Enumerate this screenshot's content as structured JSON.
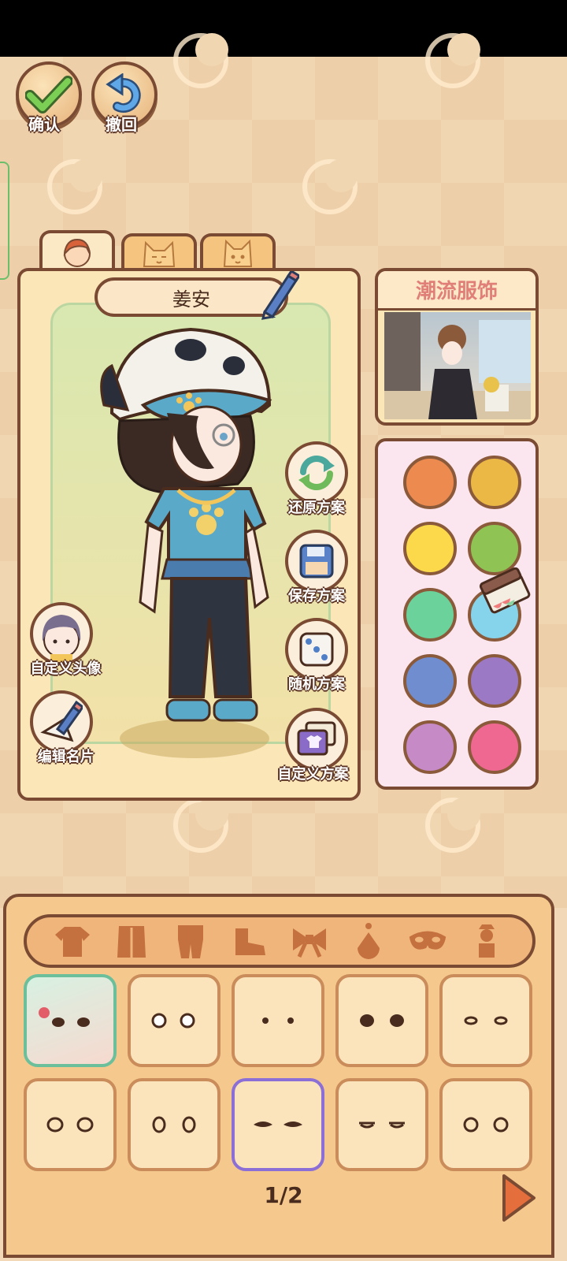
{
  "top_buttons": {
    "confirm_label": "确认",
    "undo_label": "撤回"
  },
  "character": {
    "name": "姜安"
  },
  "actions": {
    "restore": "还原方案",
    "save": "保存方案",
    "random": "随机方案",
    "custom": "自定义方案",
    "custom_avatar": "自定义头像",
    "edit_card": "编辑名片"
  },
  "fashion": {
    "title": "潮流服饰"
  },
  "colors": [
    "#ec8a50",
    "#ebb846",
    "#fbd94a",
    "#8fc455",
    "#6cd29c",
    "#86d4ec",
    "#6f8dcf",
    "#9b79c4",
    "#c68bc6",
    "#ee6892"
  ],
  "categories": [
    "top-icon",
    "coat-icon",
    "suit-icon",
    "shoe-icon",
    "bow-icon",
    "earring-icon",
    "mask-icon",
    "figure-icon"
  ],
  "items_count": 10,
  "pagination": {
    "page": "1/2"
  }
}
